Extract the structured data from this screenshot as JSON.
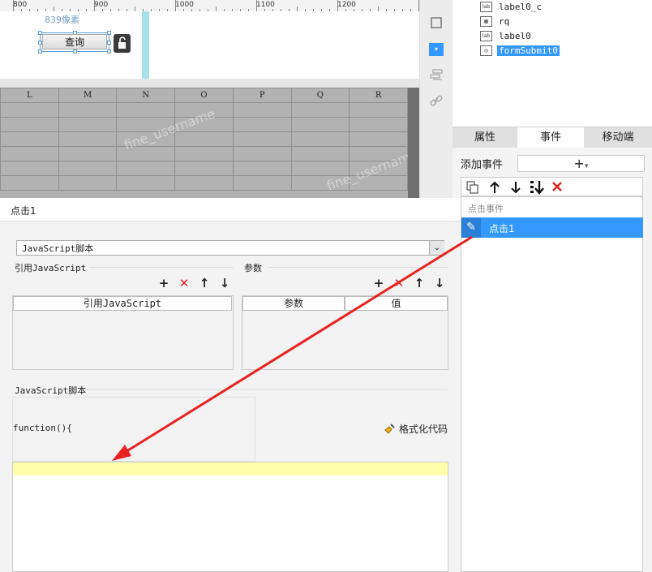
{
  "ruler": {
    "ticks": [
      "800",
      "900",
      "1000",
      "1100",
      "1200"
    ]
  },
  "canvas": {
    "pixel_label": "839像素",
    "query_button": "查询"
  },
  "grid": {
    "columns": [
      "L",
      "M",
      "N",
      "O",
      "P",
      "Q",
      "R"
    ],
    "watermark": "fine_username"
  },
  "tree": {
    "items": [
      {
        "icon": "label-icon",
        "label": "label0_c"
      },
      {
        "icon": "calendar-icon",
        "label": "rq"
      },
      {
        "icon": "label-icon",
        "label": "label0"
      },
      {
        "icon": "form-submit-icon",
        "label": "formSubmit0",
        "selected": true
      }
    ]
  },
  "tabs": [
    {
      "label": "属性"
    },
    {
      "label": "事件",
      "active": true
    },
    {
      "label": "移动端"
    }
  ],
  "events": {
    "add_event_label": "添加事件",
    "add_symbol": "+",
    "list_header": "点击事件",
    "items": [
      {
        "label": "点击1",
        "selected": true
      }
    ]
  },
  "editor": {
    "event_title": "点击1",
    "script_type": "JavaScript脚本",
    "ref_js_section": "引用JavaScript",
    "params_section": "参数",
    "ref_js_column": "引用JavaScript",
    "param_column": "参数",
    "value_column": "值",
    "js_script_section": "JavaScript脚本",
    "function_text": "function(){",
    "format_code_label": "格式化代码"
  },
  "colors": {
    "accent": "#3399ff",
    "arrow": "#e8221f",
    "highlight_line": "#ffffaa"
  }
}
